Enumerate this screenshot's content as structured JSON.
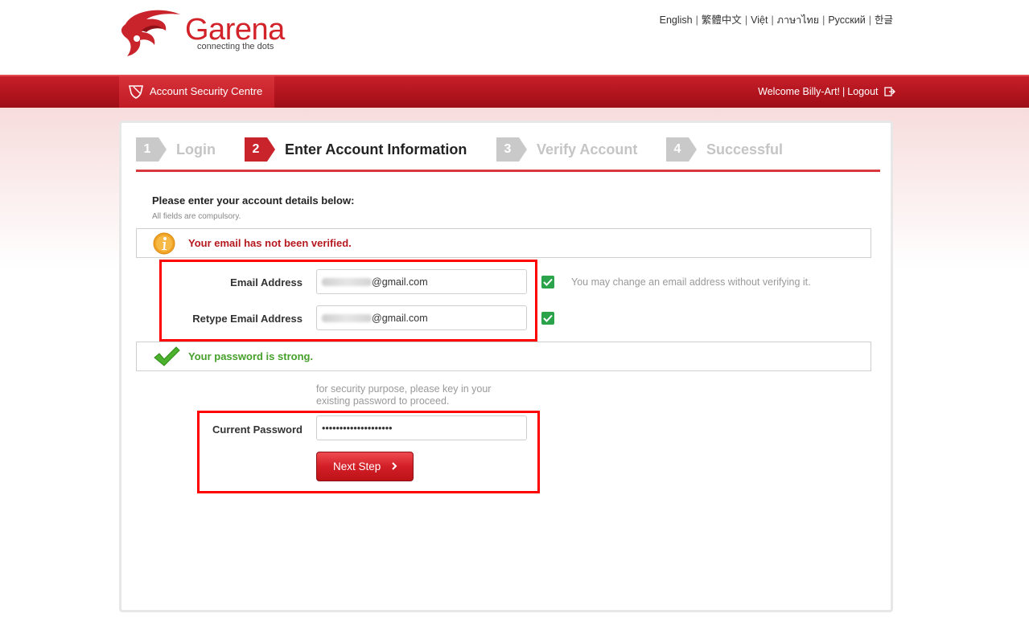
{
  "header": {
    "brand": "Garena",
    "tagline": "connecting the dots",
    "languages": [
      "English",
      "繁體中文",
      "Việt",
      "ภาษาไทย",
      "Русский",
      "한글"
    ]
  },
  "navbar": {
    "section_title": "Account Security Centre",
    "welcome": "Welcome Billy-Art!",
    "separator": "|",
    "logout": "Logout"
  },
  "steps": [
    {
      "number": "1",
      "label": "Login",
      "state": "inactive"
    },
    {
      "number": "2",
      "label": "Enter Account Information",
      "state": "active"
    },
    {
      "number": "3",
      "label": "Verify Account",
      "state": "inactive"
    },
    {
      "number": "4",
      "label": "Successful",
      "state": "inactive"
    }
  ],
  "form": {
    "heading": "Please enter your account details below:",
    "subnote": "All fields are compulsory.",
    "email_warning": "Your email has not been verified.",
    "email_label": "Email Address",
    "email_value_suffix": "@gmail.com",
    "retype_label": "Retype Email Address",
    "retype_value_suffix": "@gmail.com",
    "email_hint": "You may change an email address without verifying it.",
    "password_notice": "Your password is strong.",
    "security_note": "for security purpose, please key in your existing password to proceed.",
    "password_label": "Current Password",
    "password_value": "••••••••••••••••••••",
    "next_button": "Next Step"
  },
  "colors": {
    "brand_red": "#c9242c",
    "success_green": "#46a02b",
    "annotation_red": "#ff0000"
  }
}
